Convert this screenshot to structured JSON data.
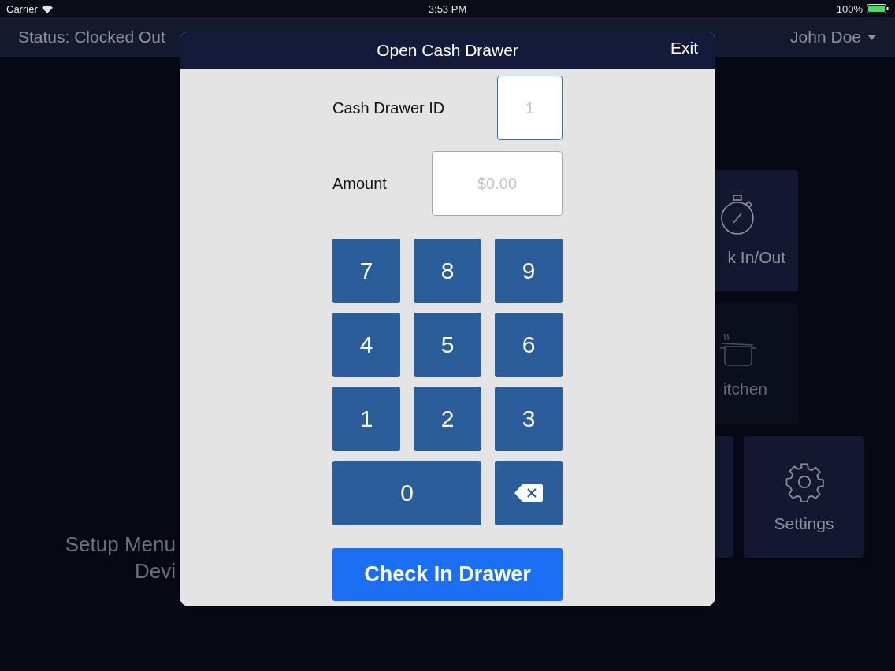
{
  "status_bar": {
    "carrier": "Carrier",
    "time": "3:53 PM",
    "battery": "100%"
  },
  "header": {
    "status": "Status: Clocked Out",
    "user": "John Doe"
  },
  "background": {
    "setup_text": [
      "Setup Menu",
      "Devi"
    ],
    "tile_rows": [
      [
        {
          "kind": "stopwatch",
          "label": "k In/Out"
        }
      ],
      [
        {
          "kind": "pot",
          "label": "itchen"
        }
      ],
      [
        {
          "kind": "blank"
        },
        {
          "kind": "gear",
          "label": "Settings"
        }
      ]
    ]
  },
  "dialog": {
    "title": "Open Cash Drawer",
    "exit": "Exit",
    "fields": [
      {
        "label": "Cash Drawer ID",
        "placeholder": "1",
        "focused": true
      },
      {
        "label": "Amount",
        "placeholder": "$0.00",
        "focused": false
      }
    ],
    "keys": [
      {
        "kind": "digit",
        "label": "7"
      },
      {
        "kind": "digit",
        "label": "8"
      },
      {
        "kind": "digit",
        "label": "9"
      },
      {
        "kind": "digit",
        "label": "4"
      },
      {
        "kind": "digit",
        "label": "5"
      },
      {
        "kind": "digit",
        "label": "6"
      },
      {
        "kind": "digit",
        "label": "1"
      },
      {
        "kind": "digit",
        "label": "2"
      },
      {
        "kind": "digit",
        "label": "3"
      },
      {
        "kind": "wide",
        "label": "0"
      },
      {
        "kind": "backspace"
      }
    ],
    "submit": "Check In Drawer"
  }
}
